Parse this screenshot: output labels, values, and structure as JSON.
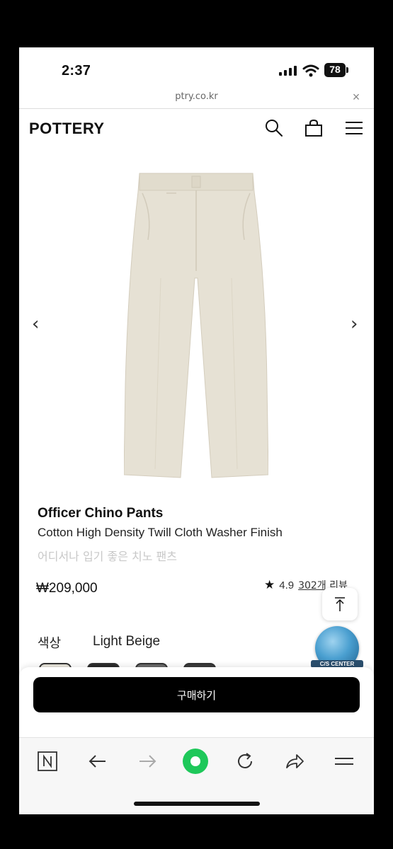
{
  "status_bar": {
    "time": "2:37",
    "battery": "78"
  },
  "browser": {
    "url": "ptry.co.kr",
    "close_label": "×"
  },
  "header": {
    "logo": "POTTERY"
  },
  "product": {
    "name": "Officer Chino Pants",
    "subtitle": "Cotton High Density Twill Cloth Washer Finish",
    "description_kr": "어디서나 입기 좋은 치노 팬츠",
    "price": "₩209,000",
    "rating": "4.9",
    "review_link": "302개 리뷰",
    "color_label": "색상",
    "color_value": "Light Beige"
  },
  "carousel": {
    "prev": "‹",
    "next": "›"
  },
  "cs_badge": {
    "label": "C/S CENTER"
  },
  "buy_button": {
    "label": "구매하기"
  },
  "colors": {
    "accent_green": "#1ec85a",
    "button_black": "#000000",
    "pants_beige": "#e6e1d4"
  }
}
